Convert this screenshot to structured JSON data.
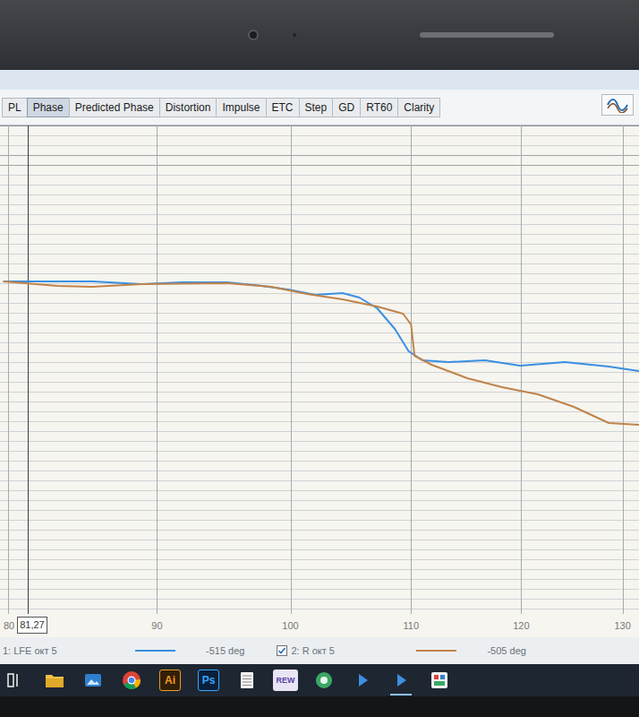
{
  "tabs": [
    {
      "label": "PL",
      "selected": false
    },
    {
      "label": "Phase",
      "selected": true
    },
    {
      "label": "Predicted Phase",
      "selected": false
    },
    {
      "label": "Distortion",
      "selected": false
    },
    {
      "label": "Impulse",
      "selected": false
    },
    {
      "label": "ETC",
      "selected": false
    },
    {
      "label": "Step",
      "selected": false
    },
    {
      "label": "GD",
      "selected": false
    },
    {
      "label": "RT60",
      "selected": false
    },
    {
      "label": "Clarity",
      "selected": false
    }
  ],
  "chart": {
    "x_ticks": [
      "80",
      "90",
      "100",
      "110",
      "120",
      "130"
    ],
    "cursor": "81,27",
    "series": [
      {
        "name": "1: LFE окт 5",
        "color": "#3a8fe2",
        "reading": "-515 deg",
        "freq_hz": [
          79.7,
          83.2,
          85.5,
          88.9,
          91.8,
          95.1,
          97.8,
          99.8,
          102,
          104.2,
          105.6,
          107.1,
          108.6,
          109.8,
          111,
          113.3,
          116.6,
          119.9,
          124.2,
          128.6,
          131.7
        ],
        "phase_deg": [
          -514,
          -514,
          -514,
          -517,
          -515,
          -515,
          -519,
          -523,
          -529,
          -527,
          -532,
          -544,
          -567,
          -592,
          -602,
          -604,
          -602,
          -608,
          -604,
          -609,
          -614
        ]
      },
      {
        "name": "2: R окт 5",
        "color": "#c0834a",
        "reading": "-505 deg",
        "checked": true,
        "freq_hz": [
          79.7,
          83.2,
          85.5,
          88.9,
          95.1,
          98.5,
          101.3,
          104.2,
          107.1,
          109.3,
          110,
          110.3,
          111.8,
          115,
          118.2,
          121.6,
          125.1,
          128.6,
          131.7
        ],
        "phase_deg": [
          -514,
          -519,
          -520,
          -517,
          -516,
          -520,
          -528,
          -534,
          -542,
          -550,
          -562,
          -597,
          -607,
          -622,
          -632,
          -640,
          -654,
          -672,
          -674
        ]
      }
    ]
  },
  "taskbar": [
    {
      "kind": "start",
      "active": false
    },
    {
      "kind": "folder",
      "active": false
    },
    {
      "kind": "photos",
      "active": false
    },
    {
      "kind": "chrome",
      "active": false
    },
    {
      "kind": "label",
      "text": "Ai",
      "active": false
    },
    {
      "kind": "label",
      "text": "Ps",
      "active": false
    },
    {
      "kind": "notepad",
      "active": false
    },
    {
      "kind": "label",
      "text": "REW",
      "active": false
    },
    {
      "kind": "globe",
      "active": false
    },
    {
      "kind": "arrow",
      "active": false
    },
    {
      "kind": "arrow",
      "active": true
    },
    {
      "kind": "app",
      "active": false
    }
  ]
}
